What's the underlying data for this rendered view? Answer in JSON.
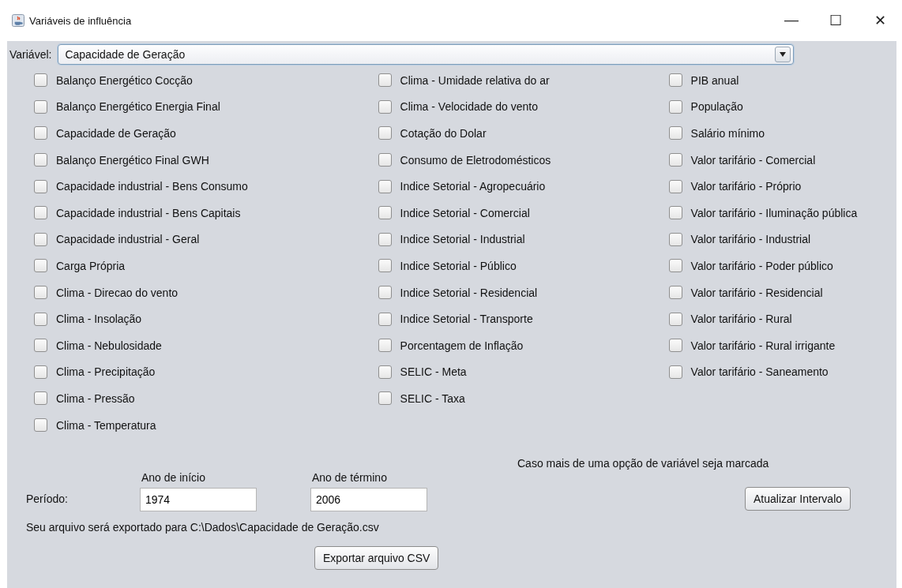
{
  "window": {
    "title": "Variáveis de influência",
    "controls": [
      "—",
      "☐",
      "✕"
    ]
  },
  "variable": {
    "label": "Variável:",
    "value": "Capacidade de Geração"
  },
  "columns": [
    {
      "items": [
        {
          "label": "Balanço Energético Cocção",
          "checked": false
        },
        {
          "label": "Balanço Energético Energia Final",
          "checked": false
        },
        {
          "label": "Capacidade de Geração",
          "checked": false
        },
        {
          "label": "Balanço Energético Final GWH",
          "checked": false
        },
        {
          "label": "Capacidade industrial - Bens Consumo",
          "checked": false
        },
        {
          "label": "Capacidade industrial - Bens Capitais",
          "checked": false
        },
        {
          "label": "Capacidade industrial - Geral",
          "checked": false
        },
        {
          "label": "Carga Própria",
          "checked": false
        },
        {
          "label": "Clima - Direcao do vento",
          "checked": false
        },
        {
          "label": "Clima - Insolação",
          "checked": false
        },
        {
          "label": "Clima - Nebulosidade",
          "checked": false
        },
        {
          "label": "Clima - Precipitação",
          "checked": false
        },
        {
          "label": "Clima - Pressão",
          "checked": false
        },
        {
          "label": "Clima - Temperatura",
          "checked": false
        }
      ]
    },
    {
      "items": [
        {
          "label": "Clima - Umidade relativa do ar",
          "checked": false
        },
        {
          "label": "Clima - Velocidade do vento",
          "checked": false
        },
        {
          "label": "Cotação do Dolar",
          "checked": false
        },
        {
          "label": "Consumo de Eletrodomésticos",
          "checked": false
        },
        {
          "label": "Indice Setorial - Agropecuário",
          "checked": false
        },
        {
          "label": "Indice Setorial - Comercial",
          "checked": false
        },
        {
          "label": "Indice Setorial - Industrial",
          "checked": false
        },
        {
          "label": "Indice Setorial - Público",
          "checked": false
        },
        {
          "label": "Indice Setorial - Residencial",
          "checked": false
        },
        {
          "label": "Indice Setorial - Transporte",
          "checked": false
        },
        {
          "label": "Porcentagem de Inflação",
          "checked": false
        },
        {
          "label": "SELIC - Meta",
          "checked": false
        },
        {
          "label": "SELIC - Taxa",
          "checked": false
        }
      ]
    },
    {
      "items": [
        {
          "label": "PIB anual",
          "checked": false
        },
        {
          "label": "População",
          "checked": false
        },
        {
          "label": "Salário mínimo",
          "checked": false
        },
        {
          "label": "Valor tarifário - Comercial",
          "checked": false
        },
        {
          "label": "Valor tarifário - Próprio",
          "checked": false
        },
        {
          "label": "Valor tarifário - Iluminação pública",
          "checked": false
        },
        {
          "label": "Valor tarifário - Industrial",
          "checked": false
        },
        {
          "label": "Valor tarifário - Poder público",
          "checked": false
        },
        {
          "label": "Valor tarifário - Residencial",
          "checked": false
        },
        {
          "label": "Valor tarifário - Rural",
          "checked": false
        },
        {
          "label": "Valor tarifário - Rural irrigante",
          "checked": false
        },
        {
          "label": "Valor tarifário - Saneamento",
          "checked": false
        }
      ]
    }
  ],
  "period": {
    "label": "Período:",
    "start_label": "Ano de início",
    "start_value": "1974",
    "end_label": "Ano de término",
    "end_value": "2006"
  },
  "note": "Caso mais de uma opção de variável seja marcada",
  "update_button": "Atualizar Intervalo",
  "export_path": "Seu arquivo será exportado para C:\\Dados\\Capacidade de Geração.csv",
  "export_button": "Exportar arquivo CSV"
}
